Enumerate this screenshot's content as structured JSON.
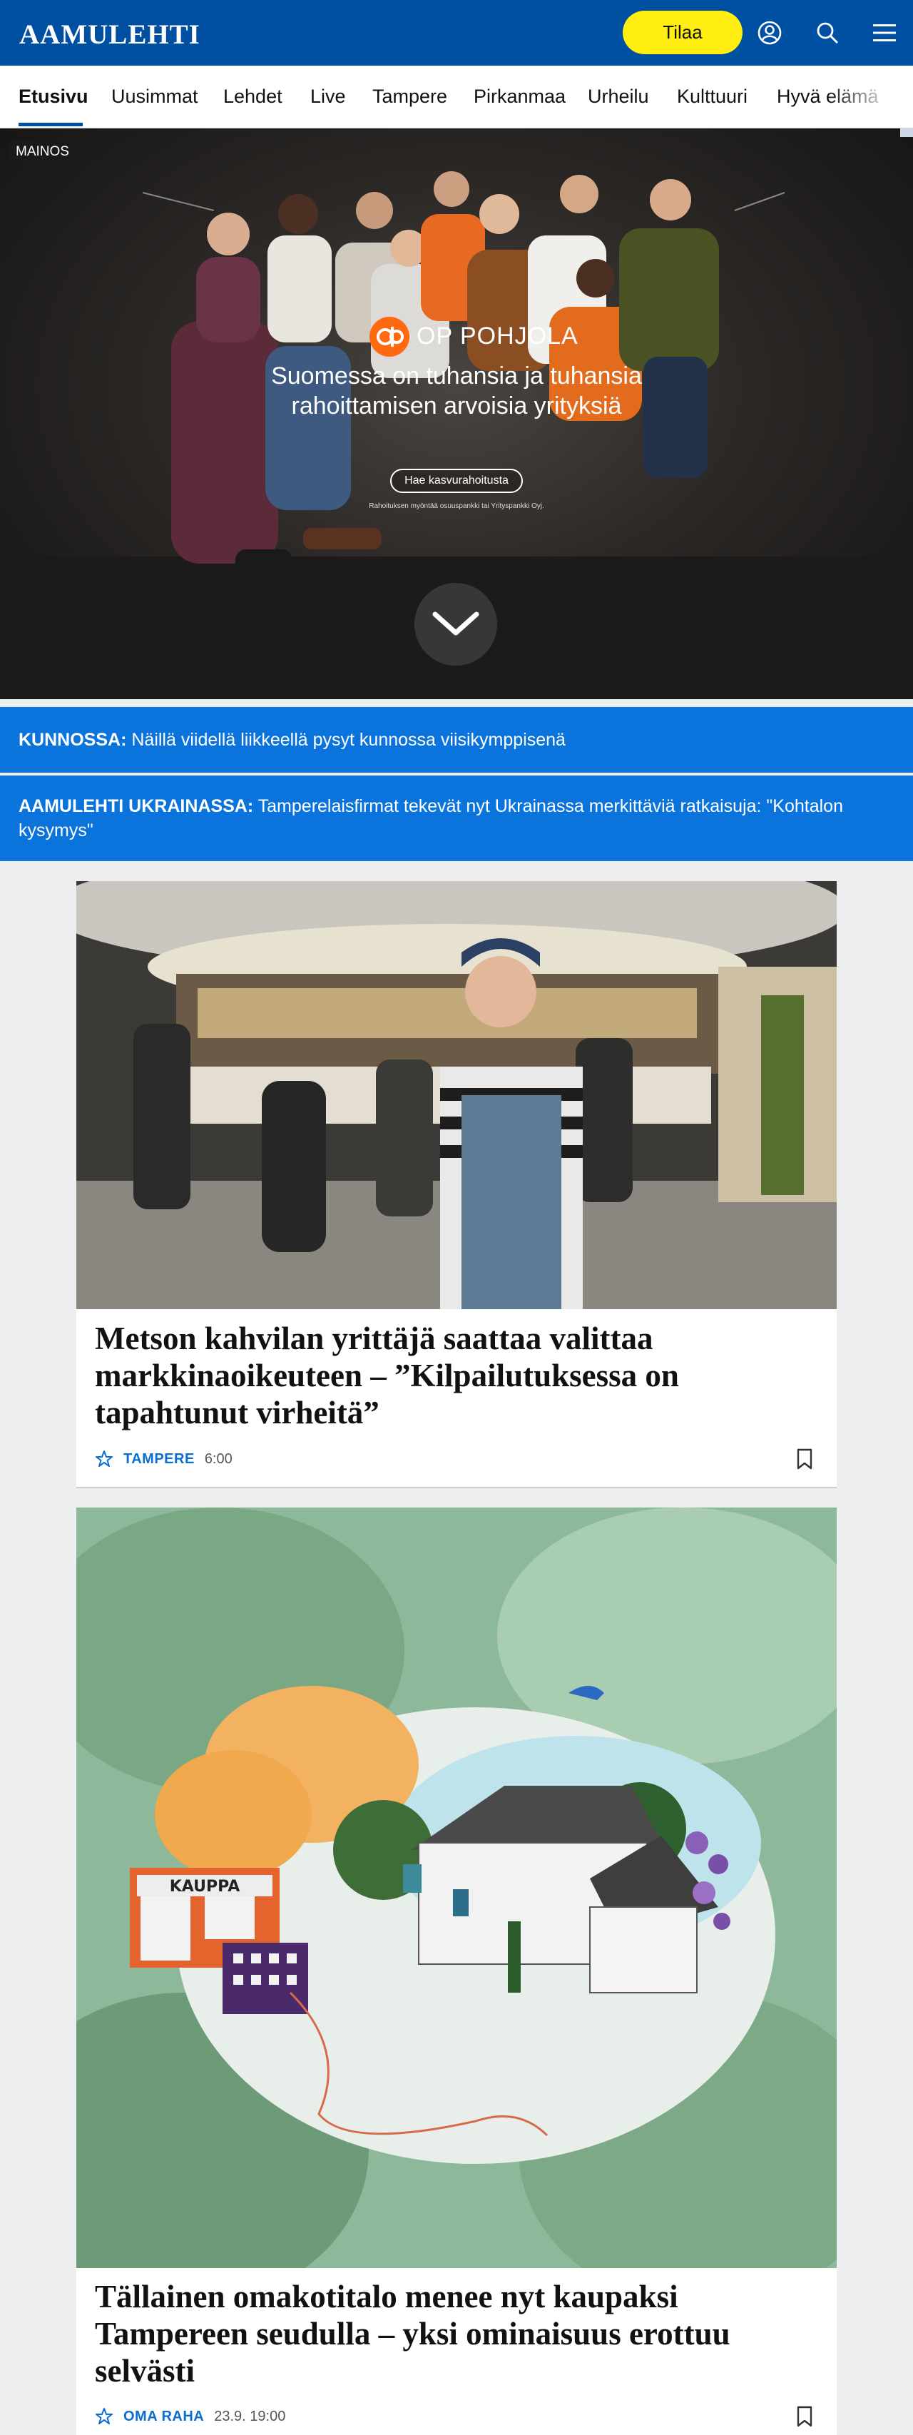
{
  "header": {
    "logo": "AAMULEHTI",
    "subscribe_label": "Tilaa",
    "icons": [
      "account-icon",
      "search-icon",
      "menu-icon"
    ]
  },
  "nav": {
    "items": [
      "Etusivu",
      "Uusimmat",
      "Lehdet",
      "Live",
      "Tampere",
      "Pirkanmaa",
      "Urheilu",
      "Kulttuuri",
      "Hyvä elämä"
    ],
    "active": "Etusivu"
  },
  "ad": {
    "label": "MAINOS",
    "brand": "OP POHJOLA",
    "headline": "Suomessa on tuhansia ja tuhansia rahoittamisen arvoisia yrityksiä",
    "cta": "Hae kasvurahoitusta",
    "fineprint": "Rahoituksen myöntää osuuspankki tai Yrityspankki Oyj."
  },
  "banners": [
    {
      "label": "KUNNOSSA:",
      "text": "Näillä viidellä liikkeellä pysyt kunnossa viisikymppisenä"
    },
    {
      "label": "AAMULEHTI UKRAINASSA:",
      "text": "Tamperelaisfirmat tekevät nyt Ukrainassa merkittäviä ratkaisuja: \"Kohtalon kysymys\""
    }
  ],
  "articles": [
    {
      "title": "Metson kahvilan yrittäjä saattaa valittaa markkinaoikeuteen – ”Kilpailutuksessa on tapahtunut virheitä”",
      "section": "TAMPERE",
      "time": "6:00"
    },
    {
      "title": "Tällainen omakotitalo menee nyt kaupaksi Tampereen seudulla – yksi ominaisuus erottuu selvästi",
      "section": "OMA RAHA",
      "time": "23.9. 19:00",
      "illustration_sign": "KAUPPA"
    }
  ],
  "colors": {
    "brand_blue": "#0050a2",
    "banner_blue": "#0a74dc",
    "subscribe_yellow": "#ffee10",
    "section_blue": "#0a6fd0"
  }
}
